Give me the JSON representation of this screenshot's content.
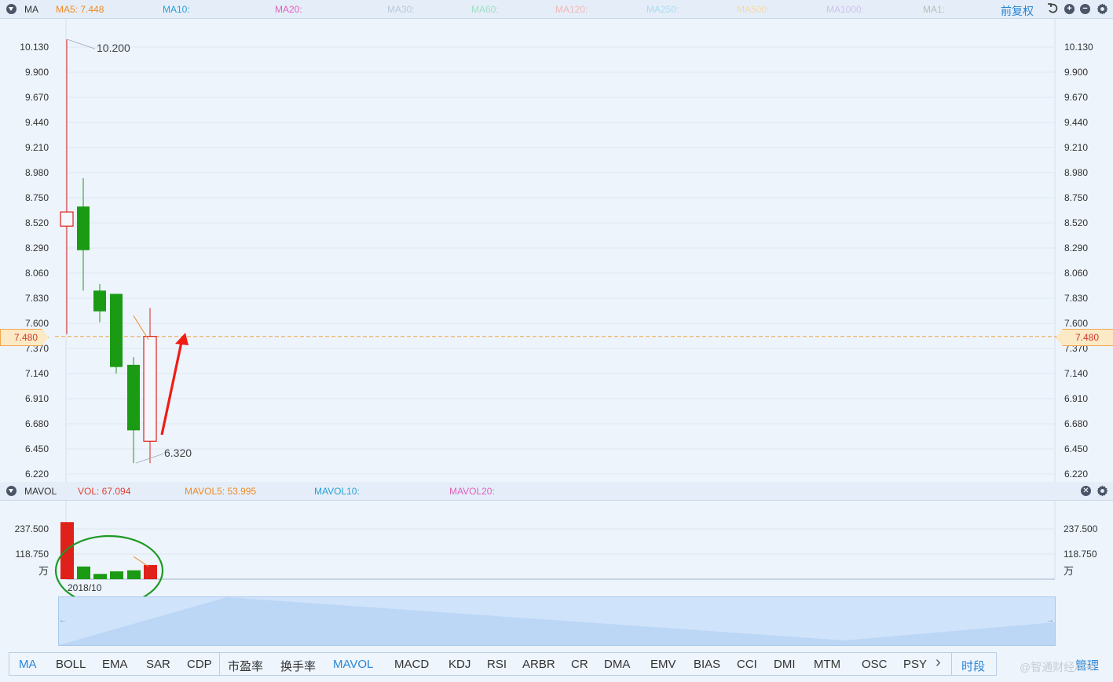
{
  "main_header": {
    "indicator": "MA",
    "ma_items": [
      {
        "label": "MA5: 7.448",
        "color": "#f08a24"
      },
      {
        "label": "MA10:",
        "color": "#2a9fd6"
      },
      {
        "label": "MA20:",
        "color": "#e05fbe"
      },
      {
        "label": "MA30:",
        "color": "#b8c8dc"
      },
      {
        "label": "MA60:",
        "color": "#9fe0c4"
      },
      {
        "label": "MA120:",
        "color": "#f0b8b8"
      },
      {
        "label": "MA250:",
        "color": "#a8dcf4"
      },
      {
        "label": "MA500:",
        "color": "#f6d8a8"
      },
      {
        "label": "MA1000:",
        "color": "#d0c0ee"
      },
      {
        "label": "MA1:",
        "color": "#bbbbbb"
      }
    ],
    "adjust_label": "前复权",
    "icons": [
      "undo-icon",
      "zoom-in-icon",
      "zoom-out-icon",
      "gear-icon"
    ]
  },
  "price_axis": {
    "ticks": [
      "10.130",
      "9.900",
      "9.670",
      "9.440",
      "9.210",
      "8.980",
      "8.750",
      "8.520",
      "8.290",
      "8.060",
      "7.830",
      "7.600",
      "7.370",
      "7.140",
      "6.910",
      "6.680",
      "6.450",
      "6.220"
    ],
    "current_price": "7.480",
    "high_label": "10.200",
    "low_label": "6.320"
  },
  "candles": [
    {
      "open": 8.49,
      "close": 8.62,
      "high": 10.2,
      "low": 7.5,
      "dir": "up"
    },
    {
      "open": 8.67,
      "close": 8.27,
      "high": 8.93,
      "low": 7.9,
      "dir": "down"
    },
    {
      "open": 7.9,
      "close": 7.71,
      "high": 7.96,
      "low": 7.61,
      "dir": "down"
    },
    {
      "open": 7.87,
      "close": 7.2,
      "high": 7.87,
      "low": 7.14,
      "dir": "down"
    },
    {
      "open": 7.22,
      "close": 6.62,
      "high": 7.29,
      "low": 6.32,
      "dir": "down"
    },
    {
      "open": 6.52,
      "close": 7.48,
      "high": 7.74,
      "low": 6.32,
      "dir": "up"
    }
  ],
  "volume_header": {
    "indicator": "MAVOL",
    "items": [
      {
        "label": "VOL: 67.094",
        "color": "#e0403a"
      },
      {
        "label": "MAVOL5: 53.995",
        "color": "#f08a24"
      },
      {
        "label": "MAVOL10:",
        "color": "#2a9fd6"
      },
      {
        "label": "MAVOL20:",
        "color": "#e05fbe"
      }
    ],
    "icons": [
      "close-icon",
      "gear-icon"
    ]
  },
  "volume_axis": {
    "ticks": [
      "237.500",
      "118.750"
    ],
    "unit": "万"
  },
  "volumes": [
    {
      "value": 270.0,
      "dir": "up"
    },
    {
      "value": 60.0,
      "dir": "down"
    },
    {
      "value": 25.0,
      "dir": "down"
    },
    {
      "value": 37.0,
      "dir": "down"
    },
    {
      "value": 42.0,
      "dir": "down"
    },
    {
      "value": 67.094,
      "dir": "up"
    }
  ],
  "date_label": "2018/10",
  "bottom_tabs": [
    "MA",
    "BOLL",
    "EMA",
    "SAR",
    "CDP",
    "市盈率",
    "换手率",
    "MAVOL",
    "MACD",
    "KDJ",
    "RSI",
    "ARBR",
    "CR",
    "DMA",
    "EMV",
    "BIAS",
    "CCI",
    "DMI",
    "MTM",
    "OSC",
    "PSY"
  ],
  "active_tabs": [
    "MA",
    "MAVOL"
  ],
  "period_tab": "时段",
  "manage_tab": "管理",
  "watermark": "@智通财经APP",
  "colors": {
    "up": "#e0201a",
    "down": "#1b9a14",
    "accent": "#2a86d5"
  }
}
